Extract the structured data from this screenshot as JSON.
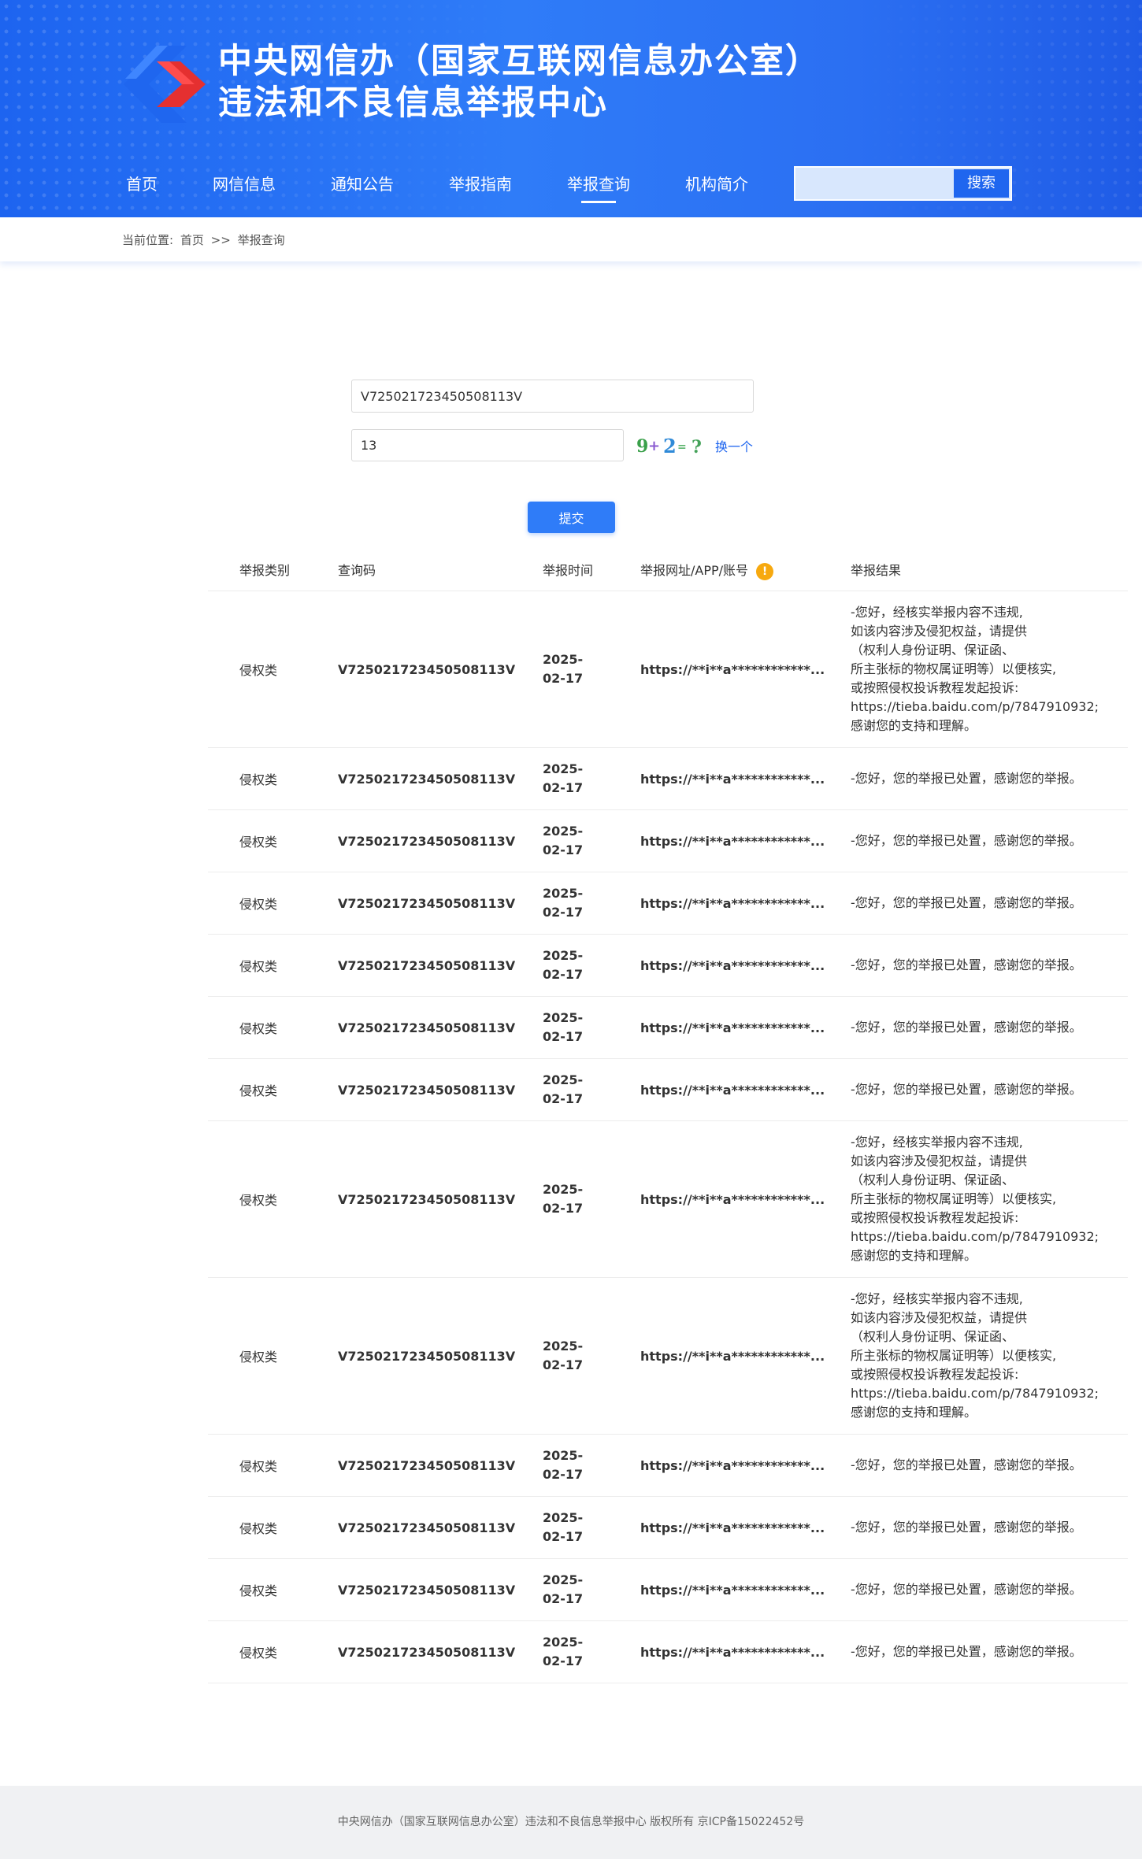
{
  "header": {
    "title_line1": "中央网信办（国家互联网信息办公室）",
    "title_line2": "违法和不良信息举报中心",
    "colors": {
      "primary": "#2f7cf8",
      "logo_blue": "#1f66ef",
      "logo_red": "#e53030"
    }
  },
  "nav": {
    "items": [
      {
        "label": "首页"
      },
      {
        "label": "网信信息"
      },
      {
        "label": "通知公告"
      },
      {
        "label": "举报指南"
      },
      {
        "label": "举报查询",
        "active": true
      },
      {
        "label": "机构简介"
      }
    ],
    "search": {
      "value": "",
      "button_label": "搜索"
    }
  },
  "breadcrumb": {
    "prefix": "当前位置:",
    "home": "首页",
    "separator": ">>",
    "current": "举报查询"
  },
  "query_form": {
    "query_code": "V725021723450508113V",
    "captcha_input": "13",
    "captcha_image_text": "9+2=?",
    "refresh_label": "换一个",
    "submit_label": "提交"
  },
  "table": {
    "headers": [
      "举报类别",
      "查询码",
      "举报时间",
      "举报网址/APP/账号",
      "举报结果"
    ],
    "header_info_icon": "warning-icon",
    "rows": [
      {
        "category": "侵权类",
        "code": "V725021723450508113V",
        "date_1": "2025-",
        "date_2": "02-17",
        "url": "https://**i**a************...",
        "result": [
          "-您好，经核实举报内容不违规,",
          "如该内容涉及侵犯权益，请提供",
          "（权利人身份证明、保证函、",
          "所主张标的物权属证明等）以便核实,",
          "或按照侵权投诉教程发起投诉:",
          "https://tieba.baidu.com/p/7847910932;",
          "感谢您的支持和理解。"
        ]
      },
      {
        "category": "侵权类",
        "code": "V725021723450508113V",
        "date_1": "2025-",
        "date_2": "02-17",
        "url": "https://**i**a************...",
        "result": [
          "-您好，您的举报已处置，感谢您的举报。"
        ]
      },
      {
        "category": "侵权类",
        "code": "V725021723450508113V",
        "date_1": "2025-",
        "date_2": "02-17",
        "url": "https://**i**a************...",
        "result": [
          "-您好，您的举报已处置，感谢您的举报。"
        ]
      },
      {
        "category": "侵权类",
        "code": "V725021723450508113V",
        "date_1": "2025-",
        "date_2": "02-17",
        "url": "https://**i**a************...",
        "result": [
          "-您好，您的举报已处置，感谢您的举报。"
        ]
      },
      {
        "category": "侵权类",
        "code": "V725021723450508113V",
        "date_1": "2025-",
        "date_2": "02-17",
        "url": "https://**i**a************...",
        "result": [
          "-您好，您的举报已处置，感谢您的举报。"
        ]
      },
      {
        "category": "侵权类",
        "code": "V725021723450508113V",
        "date_1": "2025-",
        "date_2": "02-17",
        "url": "https://**i**a************...",
        "result": [
          "-您好，您的举报已处置，感谢您的举报。"
        ]
      },
      {
        "category": "侵权类",
        "code": "V725021723450508113V",
        "date_1": "2025-",
        "date_2": "02-17",
        "url": "https://**i**a************...",
        "result": [
          "-您好，您的举报已处置，感谢您的举报。"
        ]
      },
      {
        "category": "侵权类",
        "code": "V725021723450508113V",
        "date_1": "2025-",
        "date_2": "02-17",
        "url": "https://**i**a************...",
        "result": [
          "-您好，经核实举报内容不违规,",
          "如该内容涉及侵犯权益，请提供",
          "（权利人身份证明、保证函、",
          "所主张标的物权属证明等）以便核实,",
          "或按照侵权投诉教程发起投诉:",
          "https://tieba.baidu.com/p/7847910932;",
          "感谢您的支持和理解。"
        ]
      },
      {
        "category": "侵权类",
        "code": "V725021723450508113V",
        "date_1": "2025-",
        "date_2": "02-17",
        "url": "https://**i**a************...",
        "result": [
          "-您好，经核实举报内容不违规,",
          "如该内容涉及侵犯权益，请提供",
          "（权利人身份证明、保证函、",
          "所主张标的物权属证明等）以便核实,",
          "或按照侵权投诉教程发起投诉:",
          "https://tieba.baidu.com/p/7847910932;",
          "感谢您的支持和理解。"
        ]
      },
      {
        "category": "侵权类",
        "code": "V725021723450508113V",
        "date_1": "2025-",
        "date_2": "02-17",
        "url": "https://**i**a************...",
        "result": [
          "-您好，您的举报已处置，感谢您的举报。"
        ]
      },
      {
        "category": "侵权类",
        "code": "V725021723450508113V",
        "date_1": "2025-",
        "date_2": "02-17",
        "url": "https://**i**a************...",
        "result": [
          "-您好，您的举报已处置，感谢您的举报。"
        ]
      },
      {
        "category": "侵权类",
        "code": "V725021723450508113V",
        "date_1": "2025-",
        "date_2": "02-17",
        "url": "https://**i**a************...",
        "result": [
          "-您好，您的举报已处置，感谢您的举报。"
        ]
      },
      {
        "category": "侵权类",
        "code": "V725021723450508113V",
        "date_1": "2025-",
        "date_2": "02-17",
        "url": "https://**i**a************...",
        "result": [
          "-您好，您的举报已处置，感谢您的举报。"
        ]
      }
    ]
  },
  "footer": {
    "text": "中央网信办（国家互联网信息办公室）违法和不良信息举报中心 版权所有 京ICP备15022452号"
  }
}
